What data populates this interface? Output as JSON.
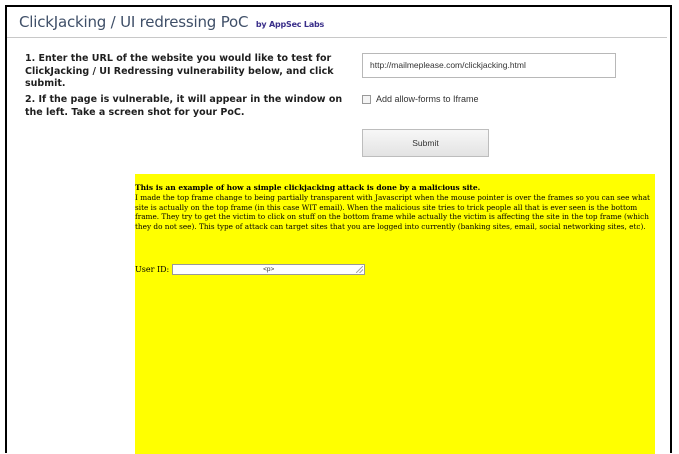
{
  "header": {
    "title": "ClickJacking / UI redressing PoC",
    "by_label": "by AppSec Labs"
  },
  "instructions": {
    "step1": "1. Enter the URL of the website you would like to test for ClickJacking / UI Redressing vulnerability below, and click submit.",
    "step2": "2. If the page is vulnerable, it will appear in the window on the left. Take a screen shot for your PoC."
  },
  "form": {
    "url_value": "http://mailmeplease.com/clickjacking.html",
    "checkbox_label": "Add allow-forms to Iframe",
    "submit_label": "Submit"
  },
  "frame_content": {
    "heading": "This is an example of how a simple clickjacking attack is done by a malicious site.",
    "paragraph": "I made the top frame change to being partially transparent with Javascript when the mouse pointer is over the frames so you can see what site is actually on the top frame (in this case WIT email). When the malicious site tries to trick people all that is ever seen is the bottom frame. They try to get the victim to click on stuff on the bottom frame while actually the victim is affecting the site in the top frame (which they do not see). This type of attack can target sites that you are logged into currently (banking sites, email, social networking sites, etc).",
    "userid_label": "User ID:",
    "userid_value": "<p>"
  },
  "colors": {
    "frame_background": "#ffff00",
    "title_color": "#3f4f68"
  }
}
